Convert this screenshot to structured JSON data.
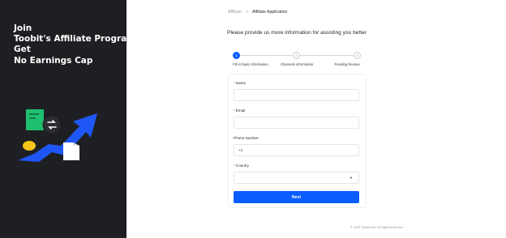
{
  "hero": {
    "line1": "Join",
    "line2": "Toobit's Affiliate Program",
    "line3": "Get",
    "line4": "No Earnings Cap"
  },
  "breadcrumb": {
    "root": "Affiliate",
    "separator": ">",
    "current": "Affiliate Application"
  },
  "heading": "Please provide us more information for assisting you better",
  "steps": [
    {
      "number": "1",
      "label": "Fill in basic information",
      "state": "active"
    },
    {
      "number": "2",
      "label": "Channels information",
      "state": "pending"
    },
    {
      "number": "3",
      "label": "Pending Review",
      "state": "pending"
    }
  ],
  "form": {
    "name_label": "Name",
    "name_value": "",
    "email_label": "Email",
    "email_value": "",
    "phone_label": "Phone Number",
    "phone_code": "+1",
    "phone_value": "",
    "country_label": "Country",
    "country_value": "",
    "required_mark": "*",
    "next_label": "Next"
  },
  "footer": "© 2025 Toobit.com. All rights reserved.",
  "colors": {
    "accent": "#0a5cff",
    "left_panel_bg": "#1e1f22",
    "required": "#e8433f"
  },
  "icons": {
    "select_caret": "chevron-down-icon"
  }
}
